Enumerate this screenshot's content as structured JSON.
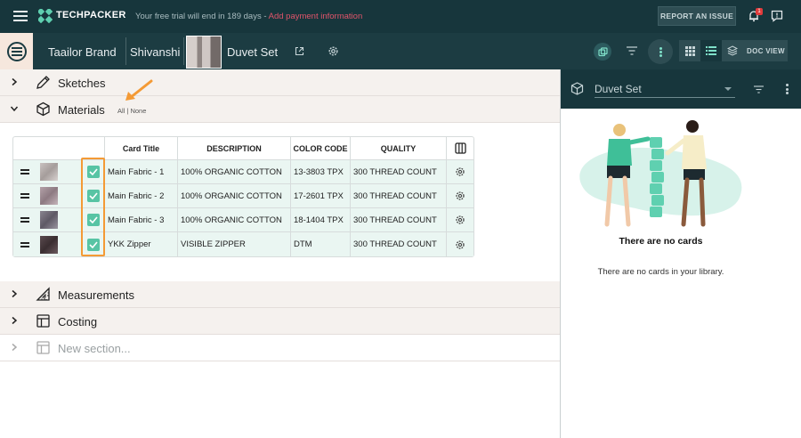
{
  "topbar": {
    "brand": "TECHPACKER",
    "trial_text": "Your free trial will end in 189 days",
    "separator": " - ",
    "payment_link": "Add payment information",
    "report_button": "REPORT AN ISSUE",
    "notification_count": "1",
    "icons": [
      "hamburger-icon",
      "logo-icon",
      "bell-icon",
      "feedback-icon"
    ]
  },
  "navbar": {
    "breadcrumbs": [
      "Taailor Brand",
      "Shivanshi",
      "Duvet Set"
    ],
    "doc_view_label": "DOC VIEW",
    "icons": [
      "app-icon",
      "external-link-icon",
      "gear-icon",
      "copy-icon",
      "filter-icon",
      "more-vertical-icon",
      "grid-view-icon",
      "list-view-icon",
      "layers-icon"
    ]
  },
  "sections": {
    "sketches": "Sketches",
    "materials": "Materials",
    "all_label": "All",
    "none_label": "None",
    "measurements": "Measurements",
    "costing": "Costing",
    "new_section_placeholder": "New section..."
  },
  "table": {
    "headers": {
      "title": "Card Title",
      "description": "DESCRIPTION",
      "color_code": "COLOR CODE",
      "quality": "QUALITY"
    },
    "rows": [
      {
        "title": "Main Fabric  - 1",
        "description": "100% ORGANIC COTTON",
        "color_code": "13-3803 TPX",
        "quality": "300 THREAD COUNT",
        "checked": true
      },
      {
        "title": "Main Fabric  - 2",
        "description": "100% ORGANIC COTTON",
        "color_code": "17-2601 TPX",
        "quality": "300 THREAD COUNT",
        "checked": true
      },
      {
        "title": "Main Fabric  - 3",
        "description": "100% ORGANIC COTTON",
        "color_code": "18-1404 TPX",
        "quality": "300 THREAD COUNT",
        "checked": true
      },
      {
        "title": "YKK Zipper",
        "description": "VISIBLE ZIPPER",
        "color_code": "DTM",
        "quality": "300 THREAD COUNT",
        "checked": true
      }
    ]
  },
  "library": {
    "selected": "Duvet Set",
    "empty_title": "There are no cards",
    "empty_subtitle": "There are no cards in your library."
  },
  "colors": {
    "topbar": "#17363c",
    "navbar": "#1c3c42",
    "accent_teal": "#58c4a4",
    "highlight_orange": "#f49a35",
    "row_bg": "#eaf6f2",
    "link_red": "#e0546a"
  }
}
